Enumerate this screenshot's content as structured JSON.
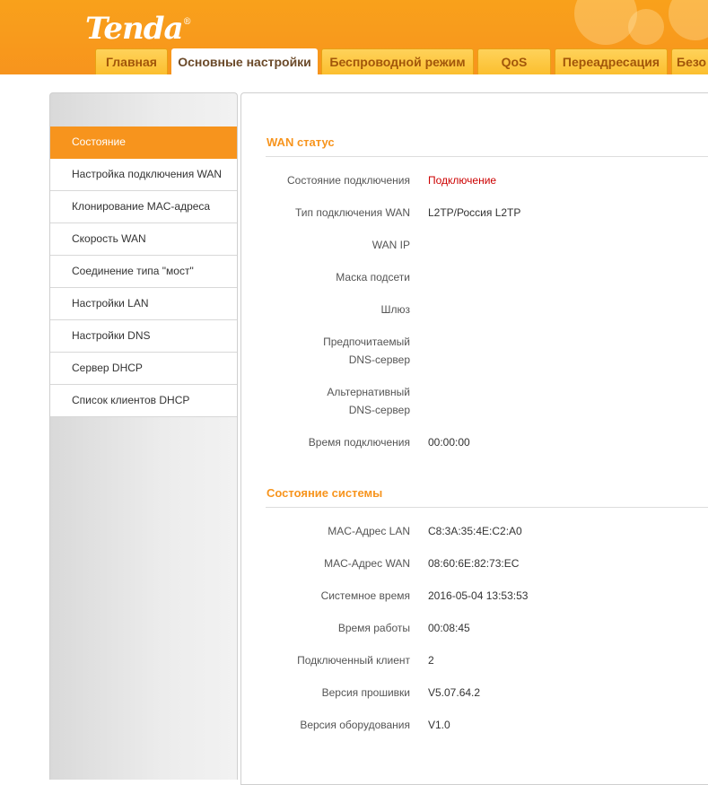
{
  "brand": {
    "logo_text": "Tenda",
    "logo_mark": "®"
  },
  "colors": {
    "accent": "#f7941d",
    "status_red": "#cc0000"
  },
  "tabs": [
    {
      "label": "Главная"
    },
    {
      "label": "Основные настройки",
      "active": true
    },
    {
      "label": "Беспроводной режим"
    },
    {
      "label": "QoS"
    },
    {
      "label": "Переадресация"
    },
    {
      "label": "Безо"
    }
  ],
  "sidebar": {
    "items": [
      {
        "label": "Состояние",
        "active": true
      },
      {
        "label": "Настройка подключения WAN"
      },
      {
        "label": "Клонирование MAC-адреса"
      },
      {
        "label": "Скорость WAN"
      },
      {
        "label": "Соединение типа \"мост\""
      },
      {
        "label": "Настройки LAN"
      },
      {
        "label": "Настройки DNS"
      },
      {
        "label": "Сервер DHCP"
      },
      {
        "label": "Список клиентов DHCP"
      }
    ]
  },
  "wan": {
    "title": "WAN статус",
    "rows": [
      {
        "label": "Состояние подключения",
        "value": "Подключение"
      },
      {
        "label": "Тип подключения WAN",
        "value": "L2TP/Россия L2TP"
      },
      {
        "label": "WAN IP",
        "value": ""
      },
      {
        "label": "Маска подсети",
        "value": ""
      },
      {
        "label": "Шлюз",
        "value": ""
      },
      {
        "label_line1": "Предпочитаемый",
        "label_line2": "DNS-сервер",
        "value": ""
      },
      {
        "label_line1": "Альтернативный",
        "label_line2": "DNS-сервер",
        "value": ""
      },
      {
        "label": "Время подключения",
        "value": "00:00:00"
      }
    ]
  },
  "system": {
    "title": "Состояние системы",
    "rows": [
      {
        "label": "MAC-Адрес LAN",
        "value": "C8:3A:35:4E:C2:A0"
      },
      {
        "label": "MAC-Адрес WAN",
        "value": "08:60:6E:82:73:EC"
      },
      {
        "label": "Системное время",
        "value": "2016-05-04 13:53:53"
      },
      {
        "label": "Время работы",
        "value": "00:08:45"
      },
      {
        "label": "Подключенный клиент",
        "value": "2"
      },
      {
        "label": "Версия прошивки",
        "value": "V5.07.64.2"
      },
      {
        "label": "Версия оборудования",
        "value": "V1.0"
      }
    ]
  }
}
